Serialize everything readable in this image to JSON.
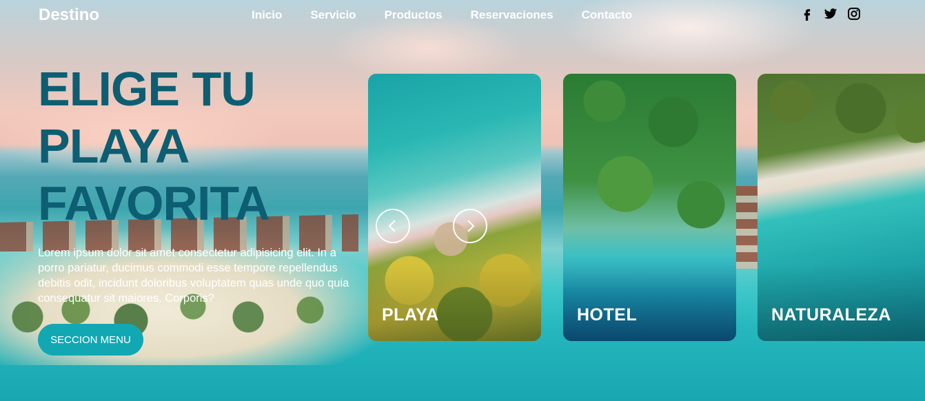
{
  "header": {
    "logo": "Destino",
    "nav": [
      "Inicio",
      "Servicio",
      "Productos",
      "Reservaciones",
      "Contacto"
    ],
    "social_icons": [
      "facebook-icon",
      "twitter-icon",
      "instagram-icon"
    ]
  },
  "hero": {
    "title": "ELIGE TU PLAYA FAVORITA",
    "text": "Lorem ipsum dolor sit amet consectetur adipisicing elit. In a porro pariatur, ducimus commodi esse tempore repellendus debitis odit, incidunt doloribus voluptatem quas unde quo quia consequatur sit maiores. Corporis?",
    "button": "SECCION MENU"
  },
  "slider": {
    "cards": [
      "PLAYA",
      "HOTEL",
      "NATURALEZA"
    ],
    "prev_icon": "chevron-left-icon",
    "next_icon": "chevron-right-icon"
  },
  "colors": {
    "title": "#0d5e72",
    "button": "#12a8b3",
    "text": "#ffffff"
  }
}
